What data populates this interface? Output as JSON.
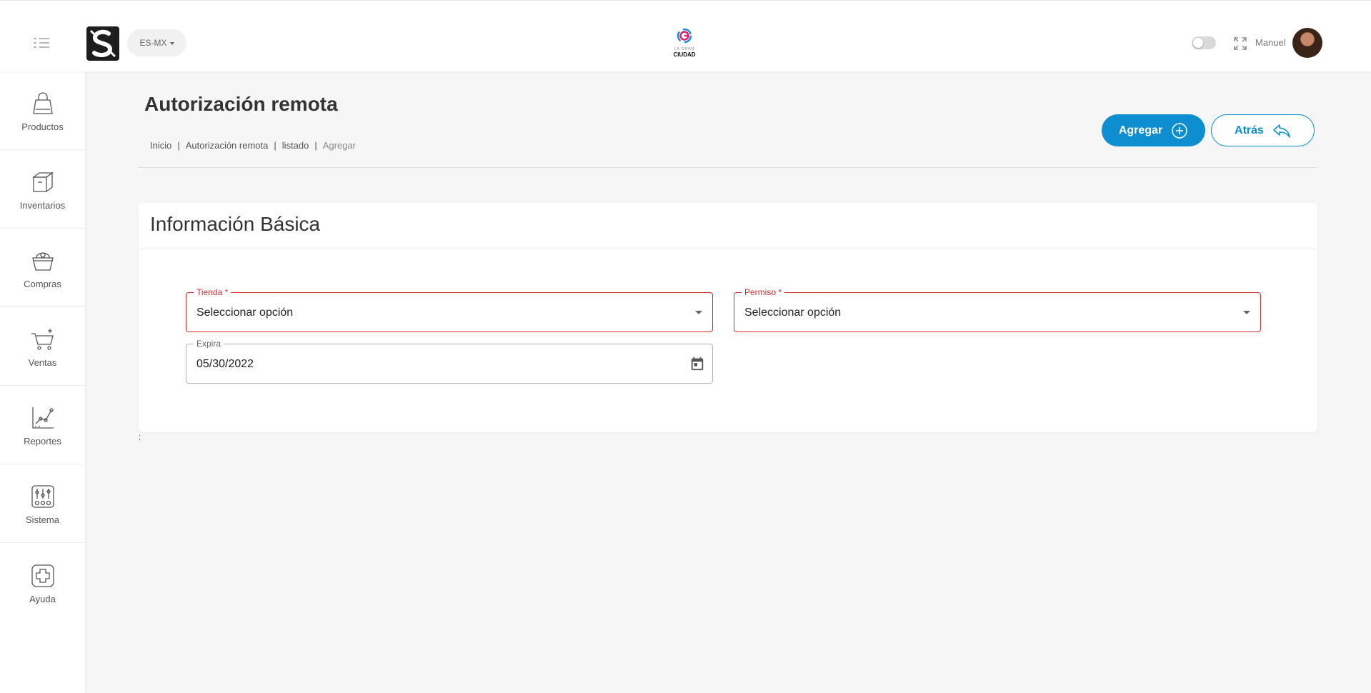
{
  "header": {
    "language": "ES-MX",
    "center_logo": {
      "line1": "LA GRAN",
      "line2": "CIUDAD"
    },
    "user_name": "Manuel"
  },
  "sidebar": {
    "items": [
      {
        "label": "Productos",
        "icon": "bag-icon"
      },
      {
        "label": "Inventarios",
        "icon": "box-icon"
      },
      {
        "label": "Compras",
        "icon": "basket-icon"
      },
      {
        "label": "Ventas",
        "icon": "cart-icon"
      },
      {
        "label": "Reportes",
        "icon": "chart-icon"
      },
      {
        "label": "Sistema",
        "icon": "sliders-icon"
      },
      {
        "label": "Ayuda",
        "icon": "help-plus-icon"
      }
    ]
  },
  "page": {
    "title": "Autorización remota",
    "breadcrumb": [
      "Inicio",
      "Autorización remota",
      "listado",
      "Agregar"
    ],
    "breadcrumb_sep": "|",
    "add_label": "Agregar",
    "back_label": "Atrás"
  },
  "form": {
    "section_title": "Información Básica",
    "tienda": {
      "label": "Tienda *",
      "value": "Seleccionar opción"
    },
    "permiso": {
      "label": "Permiso *",
      "value": "Seleccionar opción"
    },
    "expira": {
      "label": "Expira",
      "value": "05/30/2022"
    }
  },
  "stray_text": ";",
  "colors": {
    "primary": "#0d8ed1",
    "error": "#d32f2f",
    "background": "#f6f6f6"
  }
}
